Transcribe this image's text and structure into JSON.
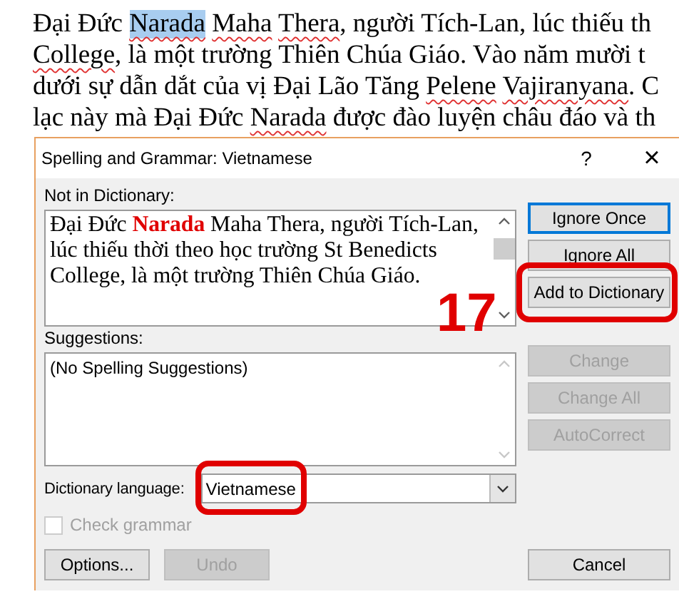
{
  "document": {
    "lines": [
      {
        "segments": [
          {
            "text": "Đại Đức ",
            "misspelled": false,
            "selected": false
          },
          {
            "text": "Narada ",
            "misspelled": true,
            "selected": true
          },
          {
            "text": "Maha ",
            "misspelled": true,
            "selected": false
          },
          {
            "text": "Thera",
            "misspelled": true,
            "selected": false
          },
          {
            "text": ", người Tích-Lan, lúc thiếu th",
            "misspelled": false,
            "selected": false
          }
        ]
      },
      {
        "segments": [
          {
            "text": "College",
            "misspelled": true,
            "selected": false
          },
          {
            "text": ", là một trường Thiên Chúa Giáo. Vào năm mười t",
            "misspelled": false,
            "selected": false
          }
        ]
      },
      {
        "segments": [
          {
            "text": "dưới sự dẫn dắt của vị Đại Lão Tăng ",
            "misspelled": false,
            "selected": false
          },
          {
            "text": "Pelene ",
            "misspelled": true,
            "selected": false
          },
          {
            "text": "Vajiranyana",
            "misspelled": true,
            "selected": false
          },
          {
            "text": ". C",
            "misspelled": false,
            "selected": false
          }
        ]
      },
      {
        "segments": [
          {
            "text": "lạc này mà Đại Đức ",
            "misspelled": false,
            "selected": false
          },
          {
            "text": "Narada",
            "misspelled": true,
            "selected": false
          },
          {
            "text": " được đào luyện châu đáo và th",
            "misspelled": false,
            "selected": false
          }
        ]
      }
    ]
  },
  "dialog": {
    "title": "Spelling and Grammar: Vietnamese",
    "help_button": "?",
    "close_button": "×",
    "not_in_dictionary": {
      "label": "Not in Dictionary:",
      "text": "Đại Đức **Narada** Maha Thera, người Tích-Lan, lúc thiếu thời theo học trường St Benedicts College, là một trường Thiên Chúa Giáo."
    },
    "suggestions": {
      "label": "Suggestions:",
      "items": [
        "(No Spelling Suggestions)"
      ]
    },
    "button_groups": [
      [
        {
          "label": "Ignore Once",
          "disabled": false,
          "focused": true,
          "highlighted": false
        },
        {
          "label": "Ignore All",
          "disabled": false,
          "focused": false,
          "highlighted": false
        },
        {
          "label": "Add to Dictionary",
          "disabled": false,
          "focused": false,
          "highlighted": true
        }
      ],
      [
        {
          "label": "Change",
          "disabled": true,
          "focused": false,
          "highlighted": false
        },
        {
          "label": "Change All",
          "disabled": true,
          "focused": false,
          "highlighted": false
        },
        {
          "label": "AutoCorrect",
          "disabled": true,
          "focused": false,
          "highlighted": false
        }
      ]
    ],
    "dictionary_language": {
      "label": "Dictionary language:",
      "value": "Vietnamese",
      "highlighted": true
    },
    "check_grammar": {
      "label": "Check grammar",
      "checked": false,
      "disabled": true
    },
    "bottom_buttons": [
      {
        "label": "Options...",
        "disabled": false
      },
      {
        "label": "Undo",
        "disabled": true
      }
    ],
    "cancel_button": {
      "label": "Cancel",
      "disabled": false
    }
  },
  "annotation": {
    "number": "17"
  }
}
